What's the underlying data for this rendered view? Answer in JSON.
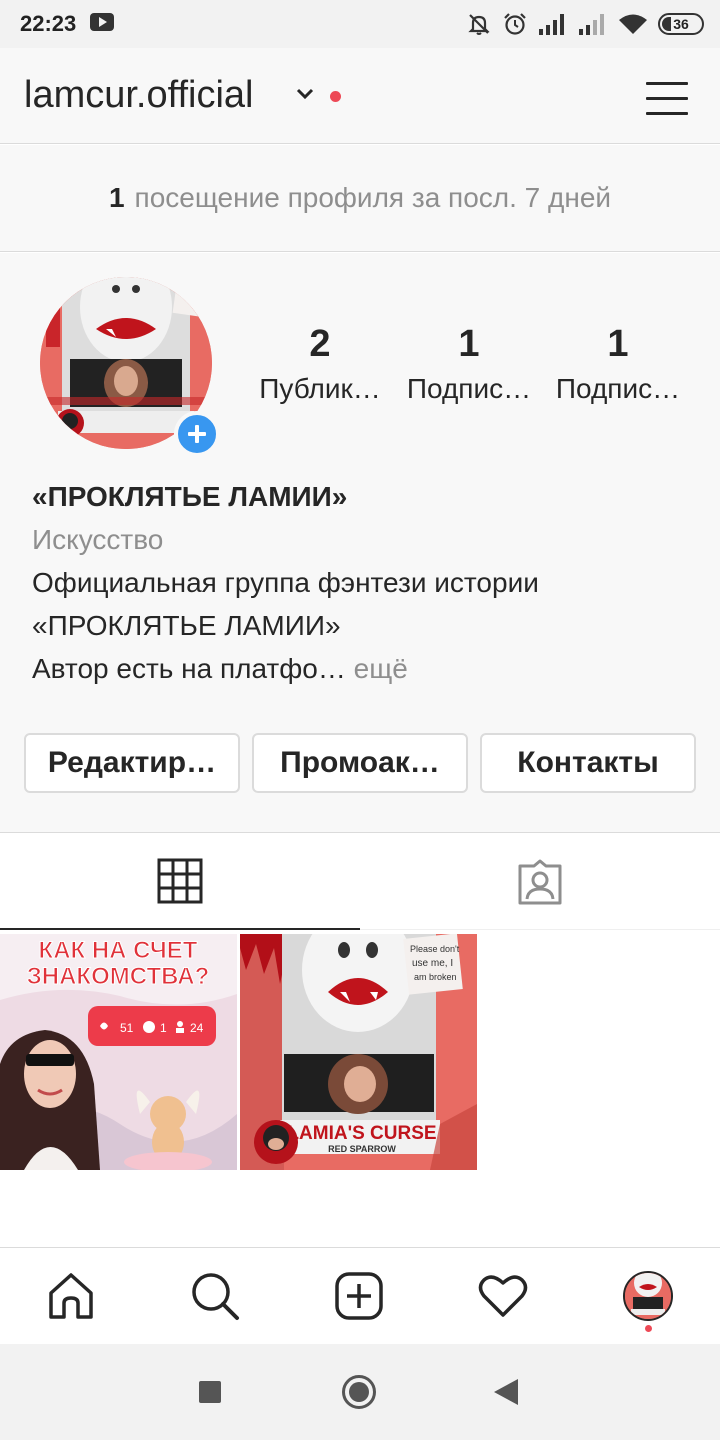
{
  "status_bar": {
    "time": "22:23",
    "battery": "36",
    "icons": [
      "youtube-icon",
      "mute-icon",
      "alarm-icon",
      "signal-icon",
      "signal-icon",
      "wifi-icon",
      "battery-icon"
    ]
  },
  "header": {
    "username": "lamcur.official",
    "menu_icon": "hamburger-icon"
  },
  "visits": {
    "count": "1",
    "text": "посещение профиля за посл. 7 дней"
  },
  "profile": {
    "stats": [
      {
        "value": "2",
        "label": "Публик…"
      },
      {
        "value": "1",
        "label": "Подпис…"
      },
      {
        "value": "1",
        "label": "Подпис…"
      }
    ],
    "name": "«ПРОКЛЯТЬЕ ЛАМИИ»",
    "category": "Искусство",
    "bio_lines": [
      "Официальная группа фэнтези истории",
      "«ПРОКЛЯТЬЕ ЛАМИИ»",
      "Автор есть на платфо…"
    ],
    "more": " ещё",
    "buttons": [
      "Редактир…",
      "Промоак…",
      "Контакты"
    ]
  },
  "posts": [
    {
      "title_lines": [
        "КАК НА СЧЕТ",
        "ЗНАКОМСТВА?"
      ],
      "likes": "51",
      "comments": "1",
      "follows": "24"
    },
    {
      "title": "LAMIA'S CURSE",
      "subtitle": "RED SPARROW",
      "note_lines": [
        "Please don't",
        "use me, I",
        "am broken"
      ]
    }
  ],
  "bottom_nav": [
    "home-icon",
    "search-icon",
    "new-post-icon",
    "heart-icon",
    "profile-avatar"
  ],
  "colors": {
    "accent_blue": "#3897f0",
    "notification_red": "#ed4956",
    "text_primary": "#262626",
    "text_secondary": "#8e8e8e"
  }
}
